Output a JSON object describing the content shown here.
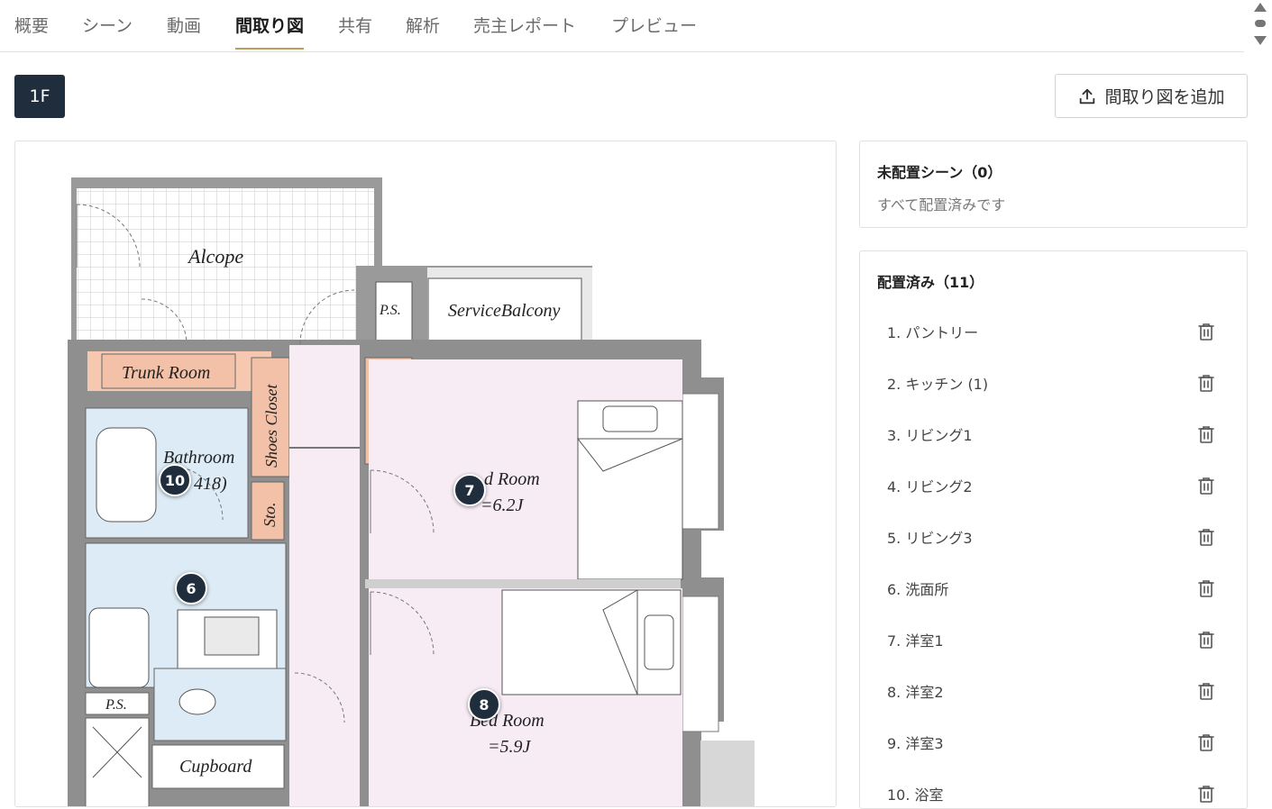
{
  "tabs": [
    {
      "label": "概要"
    },
    {
      "label": "シーン"
    },
    {
      "label": "動画"
    },
    {
      "label": "間取り図",
      "active": true
    },
    {
      "label": "共有"
    },
    {
      "label": "解析"
    },
    {
      "label": "売主レポート"
    },
    {
      "label": "プレビュー"
    }
  ],
  "floor": {
    "label": "1F"
  },
  "add_floorplan": {
    "label": "間取り図を追加",
    "icon": "upload-icon"
  },
  "floorplan": {
    "rooms": {
      "alcove": "Alcope",
      "service_balcony": "ServiceBalcony",
      "ps_top": "P.S.",
      "trunk_room": "Trunk Room",
      "shoes_closet": "Shoes Closet",
      "sto": "Sto.",
      "bathroom": "Bathroom",
      "bathroom_size": "418)",
      "bedroom1": "d Room",
      "bedroom1_size": "=6.2J",
      "bedroom2": "Bed Room",
      "bedroom2_size": "=5.9J",
      "ps_left": "P.S.",
      "cupboard": "Cupboard"
    },
    "pins": [
      {
        "label": "10"
      },
      {
        "label": "7"
      },
      {
        "label": "6"
      },
      {
        "label": "8"
      }
    ],
    "colors": {
      "pink": "#f8ecf4",
      "blue": "#dcebf6",
      "orange": "#f3c1a8",
      "wall": "#9a9a9a",
      "pin": "#1f2d3d"
    }
  },
  "unplaced": {
    "title": "未配置シーン（0）",
    "message": "すべて配置済みです"
  },
  "placed": {
    "title": "配置済み（11）",
    "items": [
      {
        "label": "1. パントリー"
      },
      {
        "label": "2. キッチン (1)"
      },
      {
        "label": "3. リビング1"
      },
      {
        "label": "4. リビング2"
      },
      {
        "label": "5. リビング3"
      },
      {
        "label": "6. 洗面所"
      },
      {
        "label": "7. 洋室1"
      },
      {
        "label": "8. 洋室2"
      },
      {
        "label": "9. 洋室3"
      },
      {
        "label": "10. 浴室"
      }
    ]
  }
}
